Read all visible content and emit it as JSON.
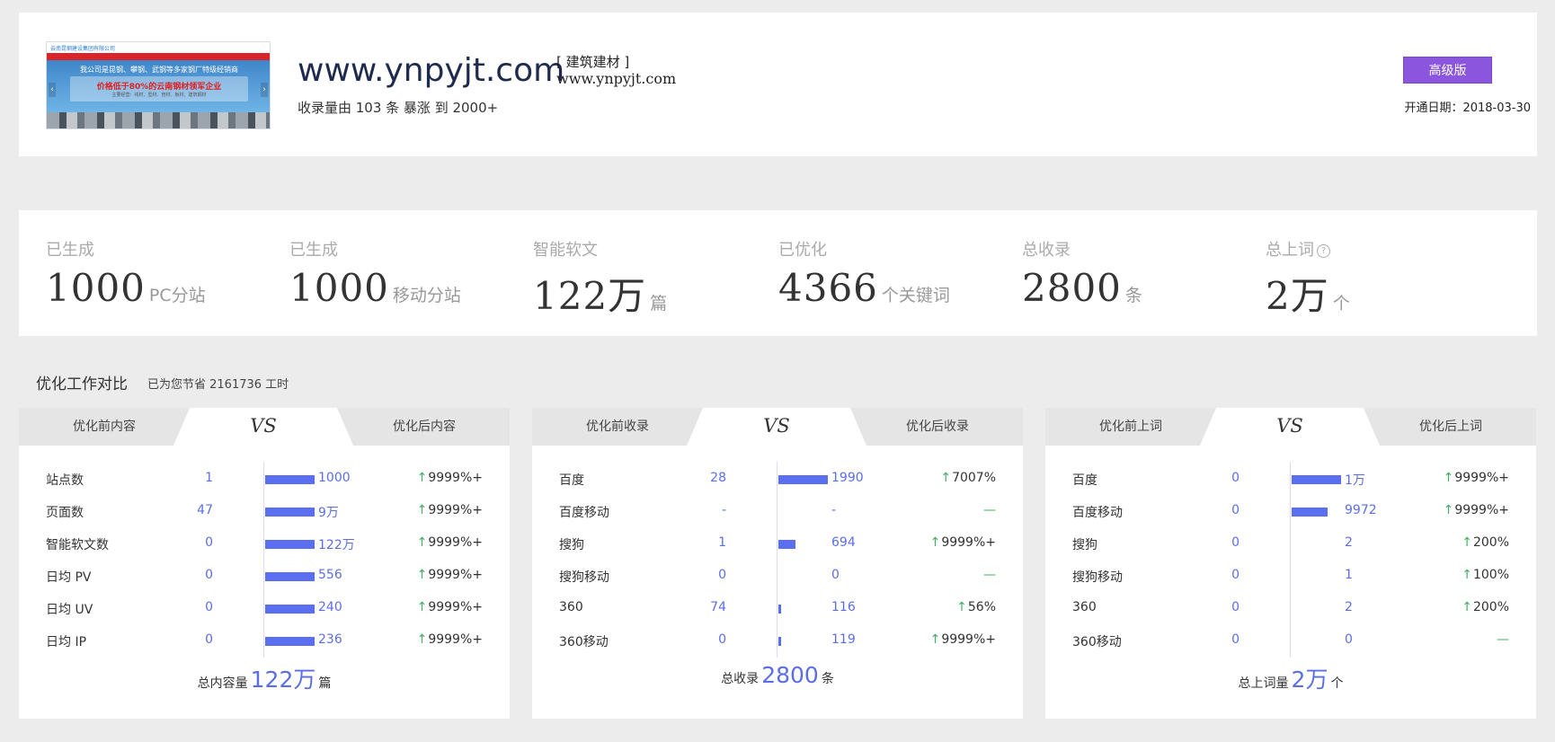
{
  "header": {
    "banner": {
      "top_text": "云南昆钢建设集团有限公司",
      "hero_line1": "我公司是昆钢、攀钢、武钢等多家钢厂特级经销商",
      "hero_line2": "价格低于80%的云南钢材领军企业",
      "hero_line3": "主要经营：线材、型材、管材、板材、建筑钢材"
    },
    "site": "www.ynpyjt.com",
    "category": "[ 建筑建材 ]",
    "site_sub": "www.ynpyjt.com",
    "tagline": "收录量由 103 条 暴涨 到 2000+",
    "version_button": "高级版",
    "open_date": "开通日期：2018-03-30"
  },
  "stats": [
    {
      "label": "已生成",
      "value": "1000",
      "unit": "PC分站"
    },
    {
      "label": "已生成",
      "value": "1000",
      "unit": "移动分站"
    },
    {
      "label": "智能软文",
      "value": "122万",
      "unit": "篇"
    },
    {
      "label": "已优化",
      "value": "4366",
      "unit": "个关键词"
    },
    {
      "label": "总收录",
      "value": "2800",
      "unit": "条"
    },
    {
      "label": "总上词",
      "value": "2万",
      "unit": "个",
      "help": "?"
    }
  ],
  "section": {
    "title": "优化工作对比",
    "subtitle": "已为您节省 2161736 工时"
  },
  "panels": [
    {
      "tab_left": "优化前内容",
      "vs": "VS",
      "tab_right": "优化后内容",
      "rows": [
        {
          "label": "站点数",
          "before": "1",
          "after": "1000",
          "bar": 1.0,
          "growth": "9999%+"
        },
        {
          "label": "页面数",
          "before": "47",
          "after": "9万",
          "bar": 1.0,
          "growth": "9999%+"
        },
        {
          "label": "智能软文数",
          "before": "0",
          "after": "122万",
          "bar": 1.0,
          "growth": "9999%+"
        },
        {
          "label": "日均 PV",
          "before": "0",
          "after": "556",
          "bar": 1.0,
          "growth": "9999%+"
        },
        {
          "label": "日均 UV",
          "before": "0",
          "after": "240",
          "bar": 1.0,
          "growth": "9999%+"
        },
        {
          "label": "日均 IP",
          "before": "0",
          "after": "236",
          "bar": 1.0,
          "growth": "9999%+"
        }
      ],
      "total_label": "总内容量",
      "total_value": "122万",
      "total_unit": "篇"
    },
    {
      "tab_left": "优化前收录",
      "vs": "VS",
      "tab_right": "优化后收录",
      "rows": [
        {
          "label": "百度",
          "before": "28",
          "after": "1990",
          "bar": 1.0,
          "growth": "7007%"
        },
        {
          "label": "百度移动",
          "before": "-",
          "after": "-",
          "bar": 0,
          "growth": "—"
        },
        {
          "label": "搜狗",
          "before": "1",
          "after": "694",
          "bar": 0.35,
          "growth": "9999%+"
        },
        {
          "label": "搜狗移动",
          "before": "0",
          "after": "0",
          "bar": 0,
          "growth": "—"
        },
        {
          "label": "360",
          "before": "74",
          "after": "116",
          "bar": 0.06,
          "growth": "56%"
        },
        {
          "label": "360移动",
          "before": "0",
          "after": "119",
          "bar": 0.06,
          "growth": "9999%+"
        }
      ],
      "total_label": "总收录",
      "total_value": "2800",
      "total_unit": "条"
    },
    {
      "tab_left": "优化前上词",
      "vs": "VS",
      "tab_right": "优化后上词",
      "rows": [
        {
          "label": "百度",
          "before": "0",
          "after": "1万",
          "bar": 1.0,
          "growth": "9999%+"
        },
        {
          "label": "百度移动",
          "before": "0",
          "after": "9972",
          "bar": 0.72,
          "growth": "9999%+"
        },
        {
          "label": "搜狗",
          "before": "0",
          "after": "2",
          "bar": 0,
          "growth": "200%"
        },
        {
          "label": "搜狗移动",
          "before": "0",
          "after": "1",
          "bar": 0,
          "growth": "100%"
        },
        {
          "label": "360",
          "before": "0",
          "after": "2",
          "bar": 0,
          "growth": "200%"
        },
        {
          "label": "360移动",
          "before": "0",
          "after": "0",
          "bar": 0,
          "growth": "—"
        }
      ],
      "total_label": "总上词量",
      "total_value": "2万",
      "total_unit": "个"
    }
  ],
  "colors": {
    "accent": "#5a6ff0",
    "button": "#8b55de",
    "up": "#3fae62"
  },
  "icons": {
    "up": "arrow-up-icon",
    "help": "question-icon"
  }
}
